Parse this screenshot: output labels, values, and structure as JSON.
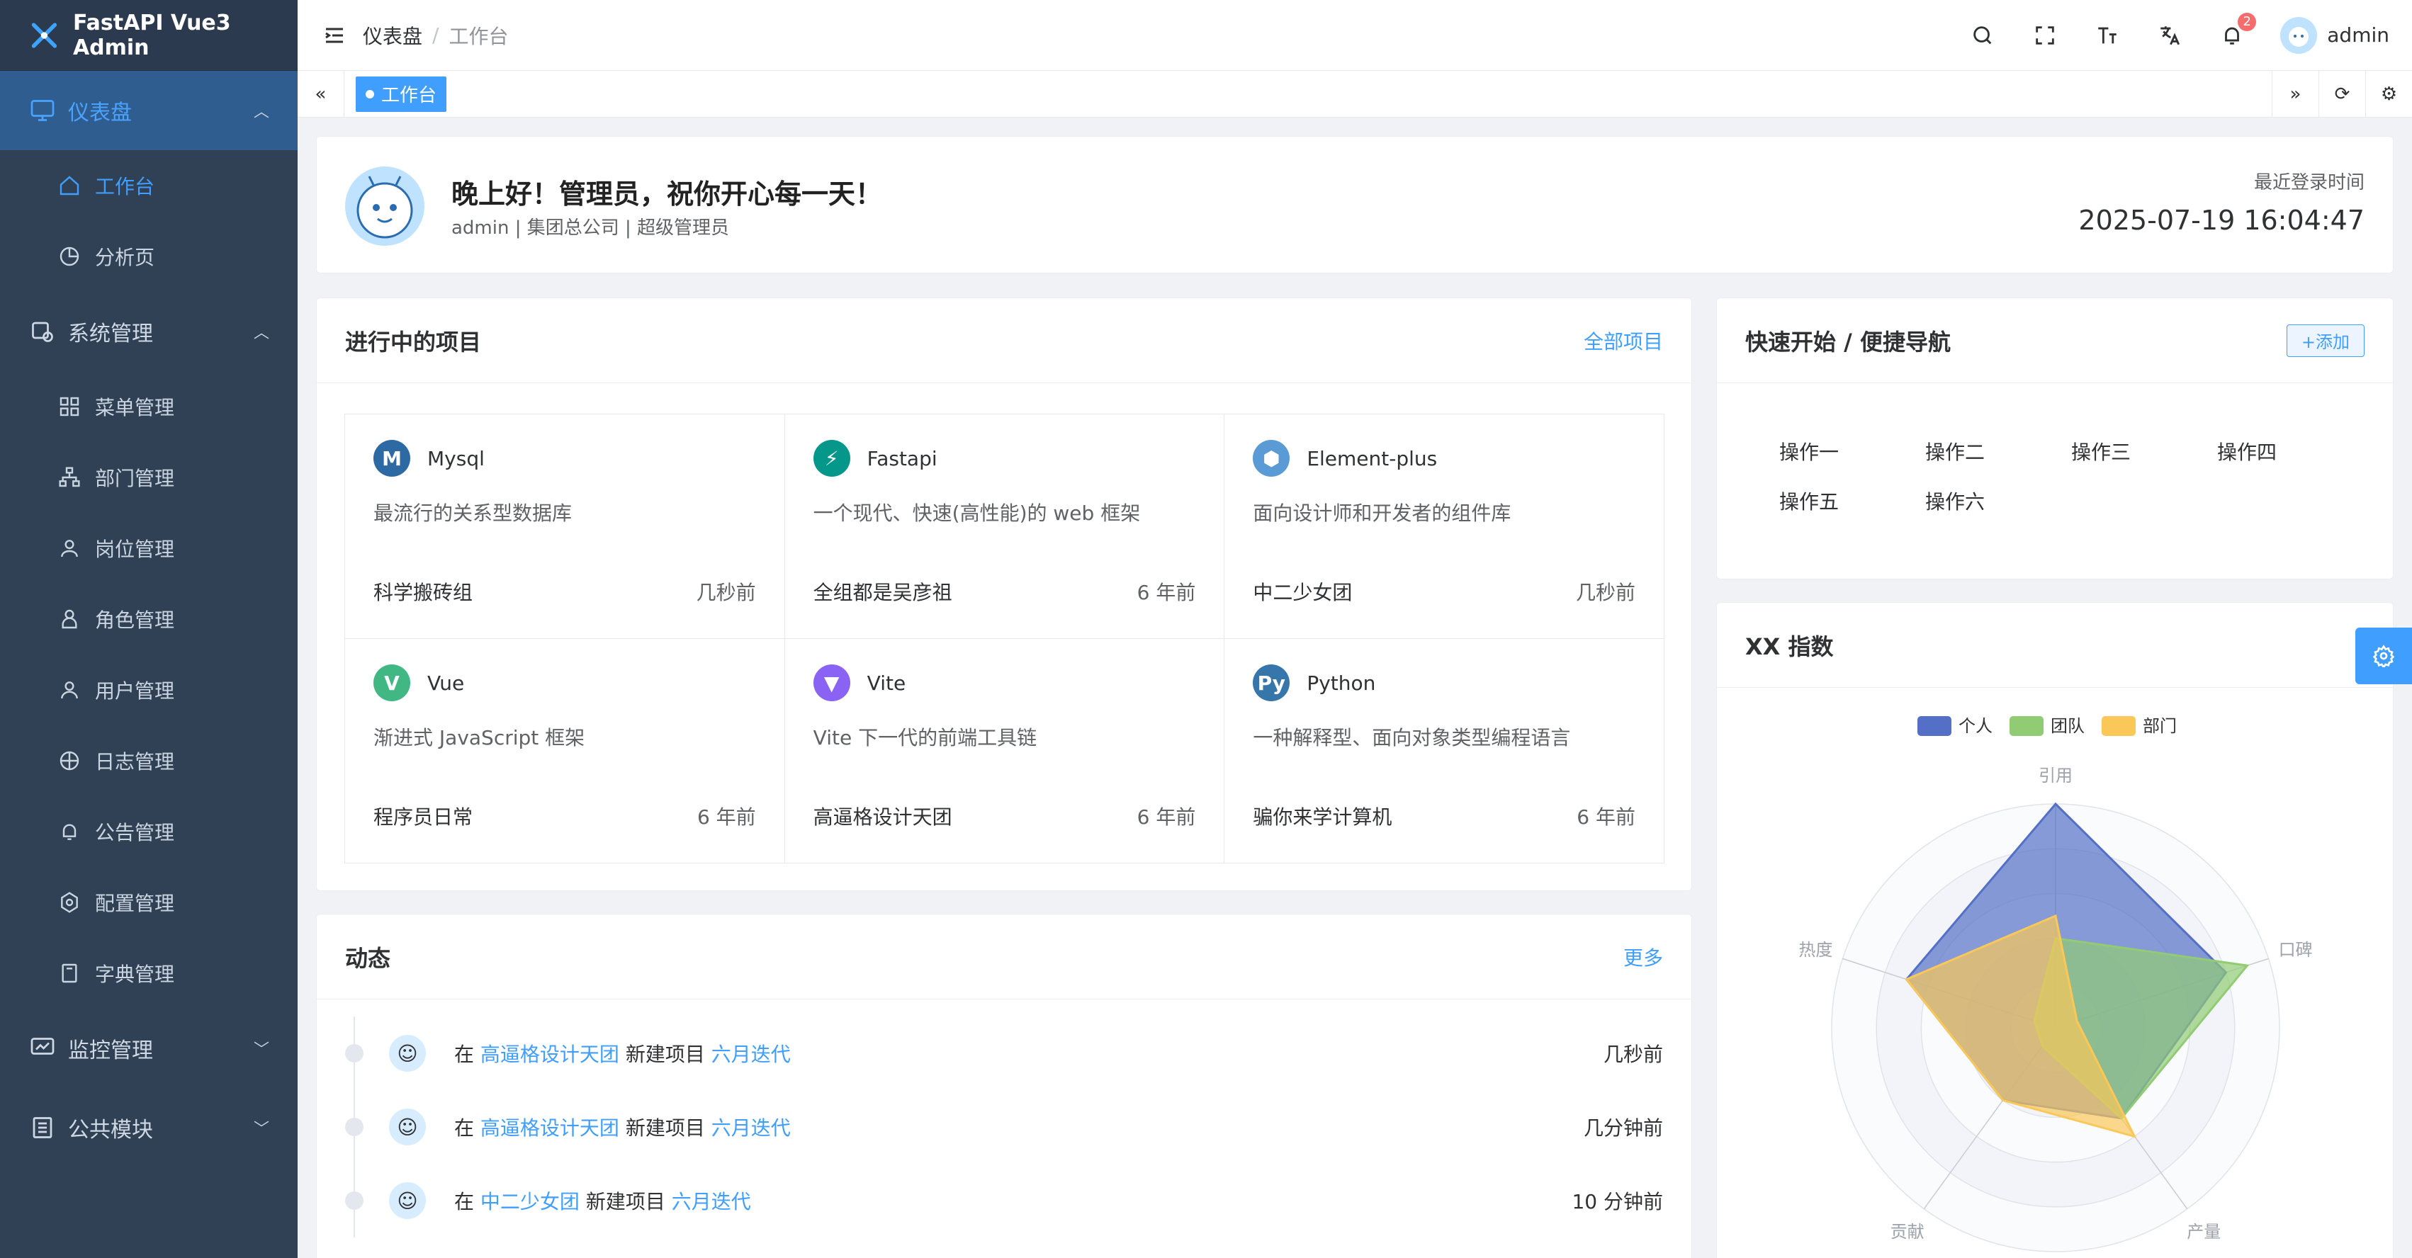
{
  "app": {
    "title": "FastAPI Vue3 Admin"
  },
  "breadcrumb": {
    "root": "仪表盘",
    "sep": "/",
    "current": "工作台"
  },
  "top_actions": {
    "notifications_count": "2",
    "username": "admin"
  },
  "tabs": {
    "active": "工作台"
  },
  "sidebar": {
    "groups": [
      {
        "label": "仪表盘",
        "items": [
          "工作台",
          "分析页"
        ]
      },
      {
        "label": "系统管理",
        "items": [
          "菜单管理",
          "部门管理",
          "岗位管理",
          "角色管理",
          "用户管理",
          "日志管理",
          "公告管理",
          "配置管理",
          "字典管理"
        ]
      },
      {
        "label": "监控管理"
      },
      {
        "label": "公共模块"
      }
    ]
  },
  "welcome": {
    "greeting": "晚上好！管理员，祝你开心每一天！",
    "subtitle": "admin | 集团总公司 | 超级管理员",
    "login_label": "最近登录时间",
    "login_time": "2025-07-19 16:04:47"
  },
  "projects": {
    "title": "进行中的项目",
    "all_link": "全部项目",
    "items": [
      {
        "name": "Mysql",
        "desc": "最流行的关系型数据库",
        "group": "科学搬砖组",
        "time": "几秒前",
        "icon": "mysql-icon",
        "color": "#2d6aa4"
      },
      {
        "name": "Fastapi",
        "desc": "一个现代、快速(高性能)的 web 框架",
        "group": "全组都是吴彦祖",
        "time": "6 年前",
        "icon": "fastapi-icon",
        "color": "#059789"
      },
      {
        "name": "Element-plus",
        "desc": "面向设计师和开发者的组件库",
        "group": "中二少女团",
        "time": "几秒前",
        "icon": "element-plus-icon",
        "color": "#5b9bd5"
      },
      {
        "name": "Vue",
        "desc": "渐进式 JavaScript 框架",
        "group": "程序员日常",
        "time": "6 年前",
        "icon": "vue-icon",
        "color": "#41b883"
      },
      {
        "name": "Vite",
        "desc": "Vite 下一代的前端工具链",
        "group": "高逼格设计天团",
        "time": "6 年前",
        "icon": "vite-icon",
        "color": "#8a63f5"
      },
      {
        "name": "Python",
        "desc": "一种解释型、面向对象类型编程语言",
        "group": "骗你来学计算机",
        "time": "6 年前",
        "icon": "python-icon",
        "color": "#3776ab"
      }
    ]
  },
  "feed": {
    "title": "动态",
    "more": "更多",
    "rows": [
      {
        "pre": "在",
        "team": "高逼格设计天团",
        "mid": "新建项目",
        "proj": "六月迭代",
        "time": "几秒前"
      },
      {
        "pre": "在",
        "team": "高逼格设计天团",
        "mid": "新建项目",
        "proj": "六月迭代",
        "time": "几分钟前"
      },
      {
        "pre": "在",
        "team": "中二少女团",
        "mid": "新建项目",
        "proj": "六月迭代",
        "time": "10 分钟前"
      }
    ]
  },
  "quick": {
    "title": "快速开始 / 便捷导航",
    "add": "+添加",
    "items": [
      "操作一",
      "操作二",
      "操作三",
      "操作四",
      "操作五",
      "操作六"
    ]
  },
  "radar": {
    "title": "XX 指数",
    "chart_data": {
      "type": "radar",
      "indicators": [
        "引用",
        "口碑",
        "产量",
        "贡献",
        "热度"
      ],
      "series": [
        {
          "name": "个人",
          "color": "#5470c6",
          "values": [
            100,
            80,
            50,
            40,
            70
          ]
        },
        {
          "name": "团队",
          "color": "#91cc75",
          "values": [
            40,
            90,
            50,
            10,
            10
          ]
        },
        {
          "name": "部门",
          "color": "#fac858",
          "values": [
            50,
            10,
            60,
            40,
            70
          ]
        }
      ]
    }
  }
}
